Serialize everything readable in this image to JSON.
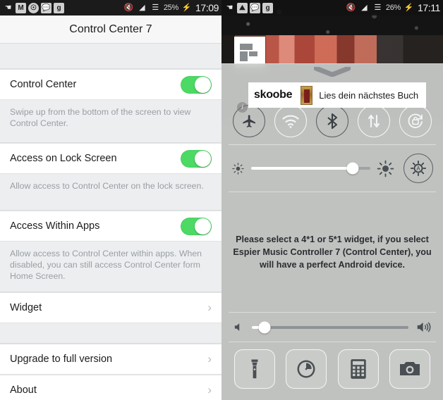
{
  "left_panel": {
    "status_bar": {
      "icons": [
        "usb-icon",
        "gmail-icon",
        "app-icon",
        "messages-icon",
        "google-plus-icon"
      ],
      "mute_icon": "mute-icon",
      "wifi_icon": "wifi-icon",
      "signal_icon": "signal-icon",
      "battery_percent": "25%",
      "battery_icon": "battery-charging-icon",
      "time": "17:09"
    },
    "title": "Control Center 7",
    "rows": [
      {
        "label": "Control Center",
        "type": "toggle",
        "state": "on",
        "description": "Swipe up from the bottom of the screen to view Control Center."
      },
      {
        "label": "Access on Lock Screen",
        "type": "toggle",
        "state": "on",
        "description": "Allow access to Control Center on the lock screen."
      },
      {
        "label": "Access Within Apps",
        "type": "toggle",
        "state": "on",
        "description": "Allow access to Control Center within apps. When disabled, you can still access Control Center form Home Screen."
      },
      {
        "label": "Widget",
        "type": "link",
        "chevron": "›"
      },
      {
        "label": "Upgrade to full version",
        "type": "link",
        "chevron": "›"
      },
      {
        "label": "About",
        "type": "link",
        "chevron": "›"
      }
    ],
    "toggle_on_color": "#4cd964"
  },
  "right_panel": {
    "status_bar": {
      "icons": [
        "usb-icon",
        "gallery-icon",
        "messages-icon",
        "google-plus-icon"
      ],
      "mute_icon": "mute-icon",
      "wifi_icon": "wifi-icon",
      "signal_icon": "signal-icon",
      "battery_percent": "26%",
      "battery_icon": "battery-charging-icon",
      "time": "17:11"
    },
    "ad": {
      "brand": "skoobe",
      "text": "Lies dein nächstes Buch",
      "info_label": "i"
    },
    "control_center": {
      "grabber": "chevron-down-grabber",
      "toggles": [
        {
          "name": "airplane-mode",
          "icon": "airplane-icon",
          "state": "on"
        },
        {
          "name": "wifi",
          "icon": "wifi-icon",
          "state": "off"
        },
        {
          "name": "bluetooth",
          "icon": "bluetooth-icon",
          "state": "on"
        },
        {
          "name": "mobile-data",
          "icon": "data-transfer-icon",
          "state": "off"
        },
        {
          "name": "rotation-lock",
          "icon": "rotation-lock-icon",
          "state": "off"
        }
      ],
      "brightness": {
        "value": 85,
        "min_icon": "brightness-low-icon",
        "max_icon": "brightness-high-icon",
        "auto_icon": "auto-brightness-icon"
      },
      "message": "Please select a 4*1 or 5*1 widget, if you select Espier Music Controller 7 (Control Center), you will have a perfect Android device.",
      "volume": {
        "value": 8,
        "min_icon": "volume-low-icon",
        "max_icon": "volume-high-icon"
      },
      "apps": [
        {
          "name": "flashlight",
          "icon": "flashlight-icon"
        },
        {
          "name": "clock",
          "icon": "clock-icon"
        },
        {
          "name": "calculator",
          "icon": "calculator-icon"
        },
        {
          "name": "camera",
          "icon": "camera-icon"
        }
      ]
    }
  }
}
